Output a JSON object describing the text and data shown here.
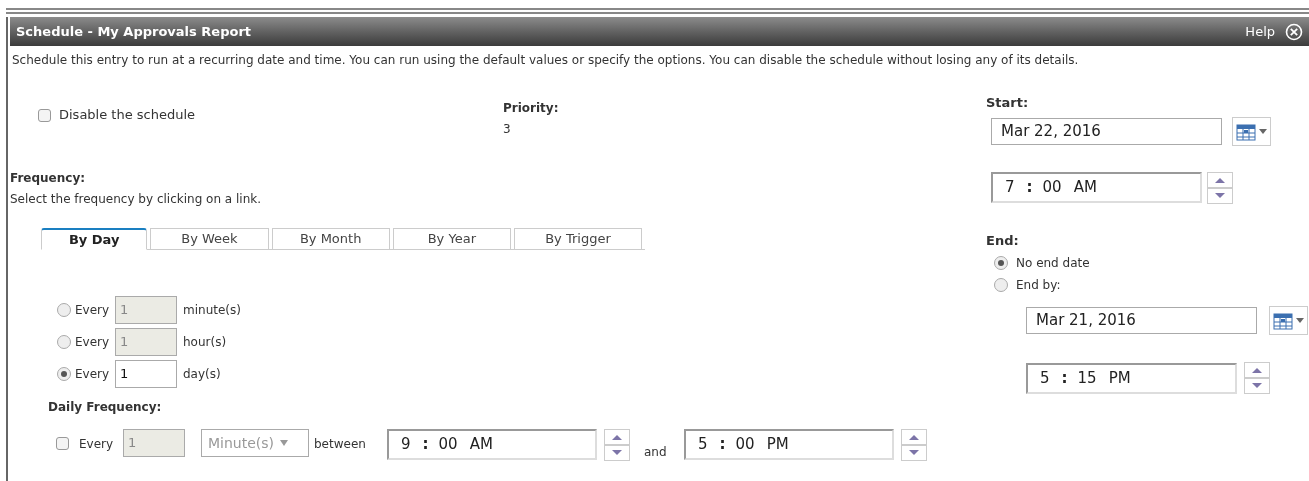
{
  "window": {
    "title": "Schedule - My Approvals Report",
    "help": "Help"
  },
  "description": "Schedule this entry to run at a recurring date and time. You can run using the default values or specify the options. You can disable the schedule without losing any of its details.",
  "disable": {
    "label": "Disable the schedule",
    "checked": false
  },
  "priority": {
    "label": "Priority:",
    "value": "3"
  },
  "frequency": {
    "label": "Frequency:",
    "hint": "Select the frequency by clicking on a link.",
    "tabs": [
      {
        "label": "By Day",
        "selected": true
      },
      {
        "label": "By Week",
        "selected": false
      },
      {
        "label": "By Month",
        "selected": false
      },
      {
        "label": "By Year",
        "selected": false
      },
      {
        "label": "By Trigger",
        "selected": false
      }
    ],
    "intervals": [
      {
        "label": "Every",
        "value": "1",
        "unit": "minute(s)",
        "selected": false
      },
      {
        "label": "Every",
        "value": "1",
        "unit": "hour(s)",
        "selected": false
      },
      {
        "label": "Every",
        "value": "1",
        "unit": "day(s)",
        "selected": true
      }
    ]
  },
  "daily_frequency": {
    "label": "Daily Frequency:",
    "checked": false,
    "every": "Every",
    "value": "1",
    "unit": "Minute(s)",
    "between": "between",
    "from": {
      "hour": "9",
      "separator": ":",
      "minute": "00",
      "period": "AM"
    },
    "and": "and",
    "to": {
      "hour": "5",
      "separator": ":",
      "minute": "00",
      "period": "PM"
    }
  },
  "start": {
    "label": "Start:",
    "date": "Mar 22, 2016",
    "time": {
      "hour": "7",
      "separator": ":",
      "minute": "00",
      "period": "AM"
    }
  },
  "end": {
    "label": "End:",
    "options": [
      {
        "label": "No end date",
        "selected": true
      },
      {
        "label": "End by:",
        "selected": false
      }
    ],
    "date": "Mar 21, 2016",
    "time": {
      "hour": "5",
      "separator": ":",
      "minute": "15",
      "period": "PM"
    }
  }
}
